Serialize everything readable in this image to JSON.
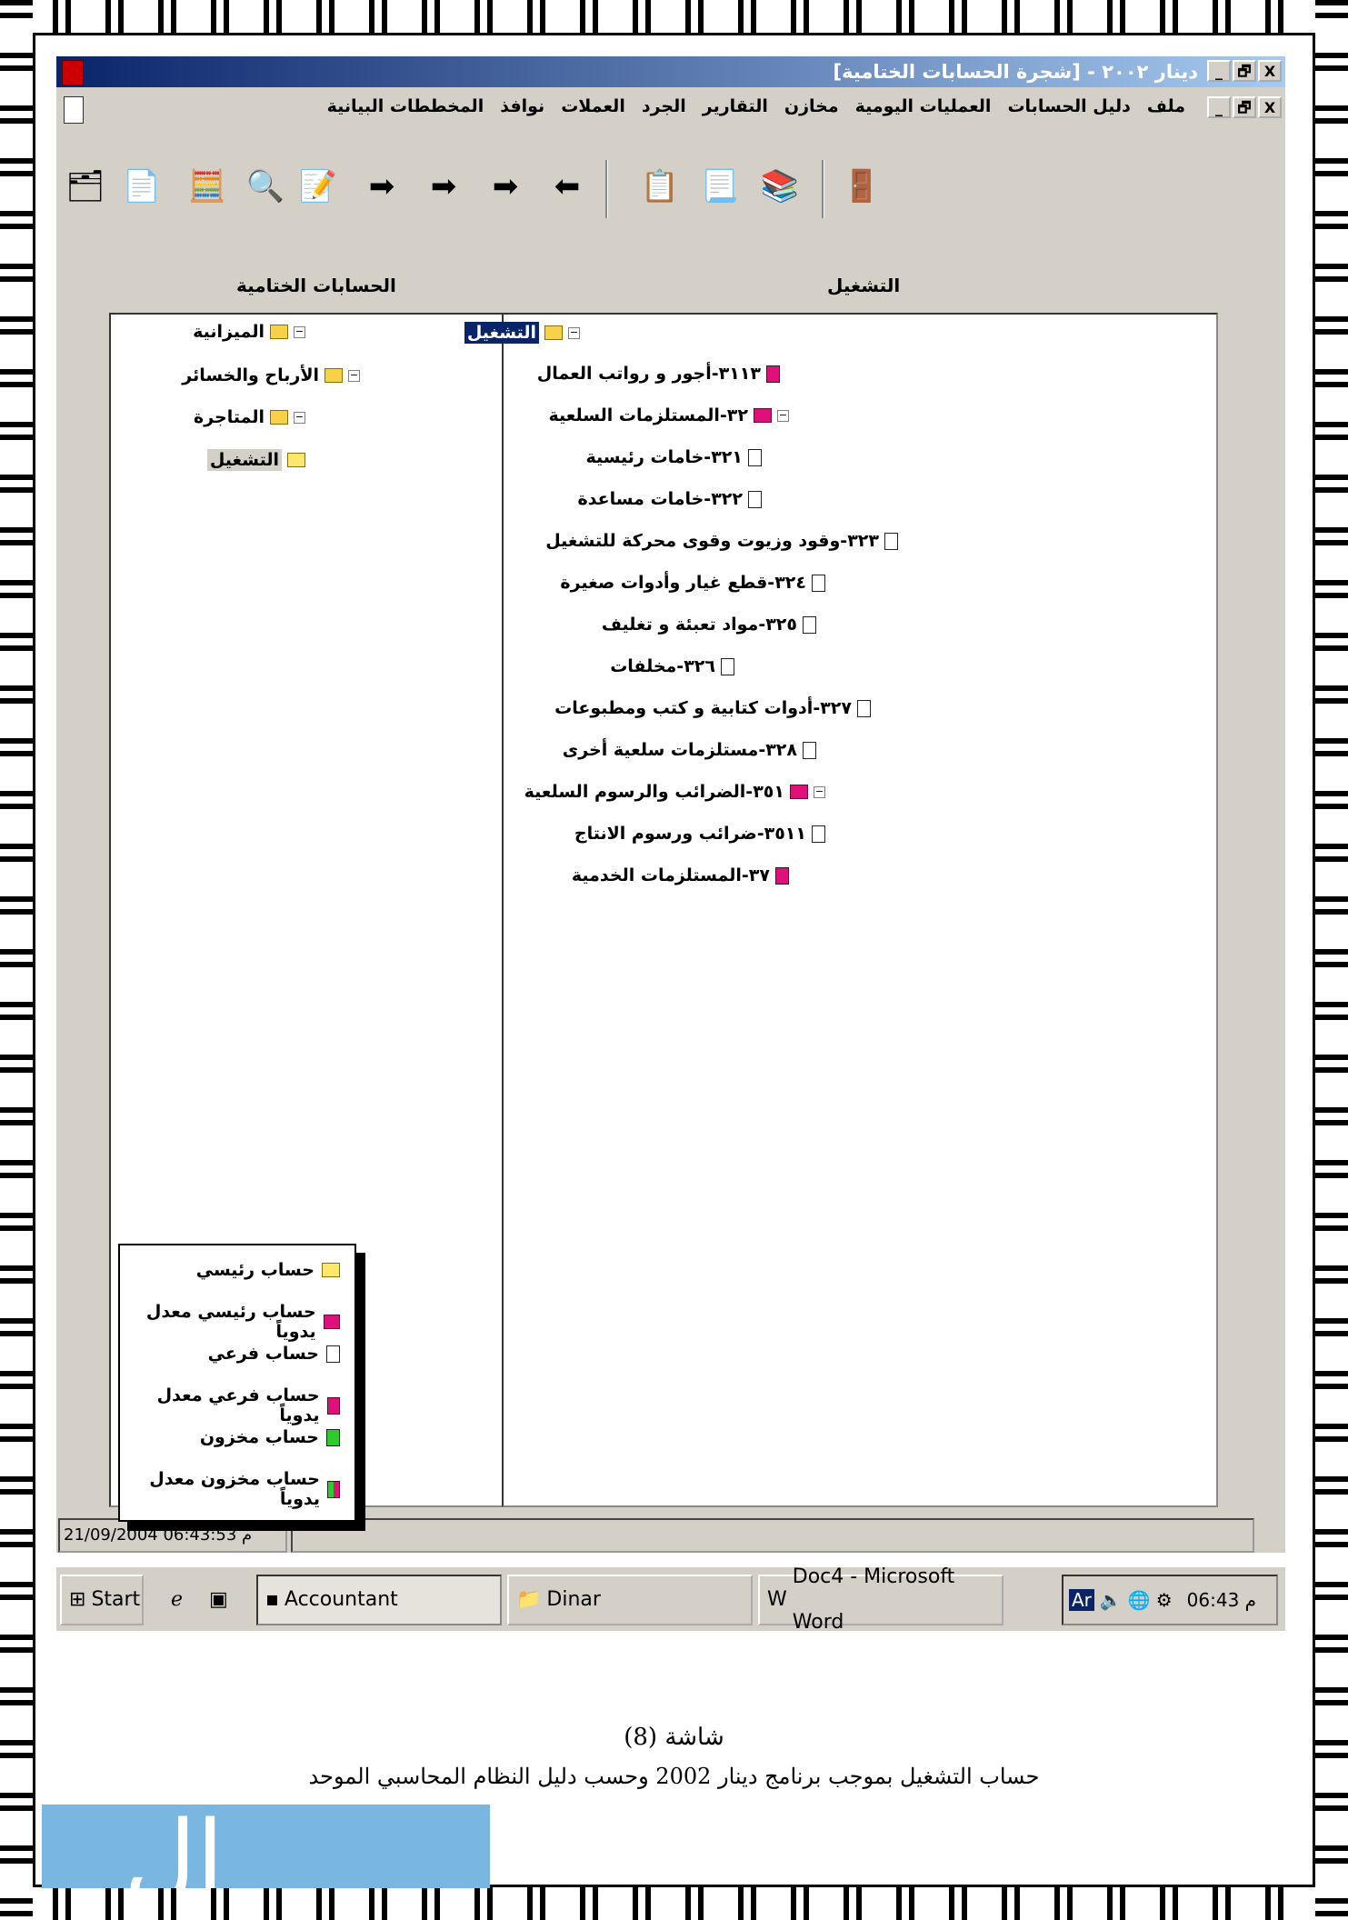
{
  "window": {
    "title": "دينار ٢٠٠٢ - [شجرة الحسابات الختامية]",
    "btn_close": "X",
    "btn_restore": "🗗",
    "btn_min": "_"
  },
  "menu": {
    "items": [
      "ملف",
      "دليل الحسابات",
      "العمليات اليومية",
      "مخازن",
      "التقارير",
      "الجرد",
      "العملات",
      "نوافذ",
      "المخططات البيانية"
    ]
  },
  "panels": {
    "left_title": "الحسابات الختامية",
    "right_title": "التشغيل"
  },
  "left_tree": {
    "n0": "الميزانية",
    "n1": "الأرباح والخسائر",
    "n2": "المتاجرة",
    "n3": "التشغيل"
  },
  "right_tree": {
    "root": "التشغيل",
    "a": "٣١١٣-أجور و رواتب العمال",
    "b": "٣٢-المستلزمات السلعية",
    "b1": "٣٢١-خامات رئيسية",
    "b2": "٣٢٢-خامات مساعدة",
    "b3": "٣٢٣-وقود وزيوت وقوى محركة للتشغيل",
    "b4": "٣٢٤-قطع غيار وأدوات صغيرة",
    "b5": "٣٢٥-مواد تعبئة و تغليف",
    "b6": "٣٢٦-مخلفات",
    "b7": "٣٢٧-أدوات كتابية و كتب ومطبوعات",
    "b8": "٣٢٨-مستلزمات سلعية أخرى",
    "c": "٣٥١-الضرائب والرسوم السلعية",
    "c1": "٣٥١١-ضرائب ورسوم الانتاج",
    "d": "٣٧-المستلزمات الخدمية"
  },
  "legend": {
    "l1": "حساب رئيسي",
    "l2": "حساب رئيسي معدل يدوياً",
    "l3": "حساب فرعي",
    "l4": "حساب فرعي معدل يدوياً",
    "l5": "حساب مخزون",
    "l6": "حساب مخزون معدل يدوياً"
  },
  "status": {
    "datetime": "21/09/2004 06:43:53 م"
  },
  "taskbar": {
    "start": "Start",
    "accountant": "Accountant",
    "dinar": "Dinar",
    "word": "Doc4 - Microsoft Word",
    "clock": "06:43 م",
    "tray_ar": "Ar"
  },
  "caption": {
    "line1": "شاشة (8)",
    "line2": "حساب التشغيل بموجب برنامج دينار 2002 وحسب دليل النظام المحاسبي الموحد"
  },
  "colors": {
    "titlebar_start": "#0a246a",
    "titlebar_end": "#a6caf0",
    "window_bg": "#d4d0c8",
    "red_icon": "#e0107a",
    "green_icon": "#2bcc2b",
    "logo_bg": "#7ab7e0"
  }
}
